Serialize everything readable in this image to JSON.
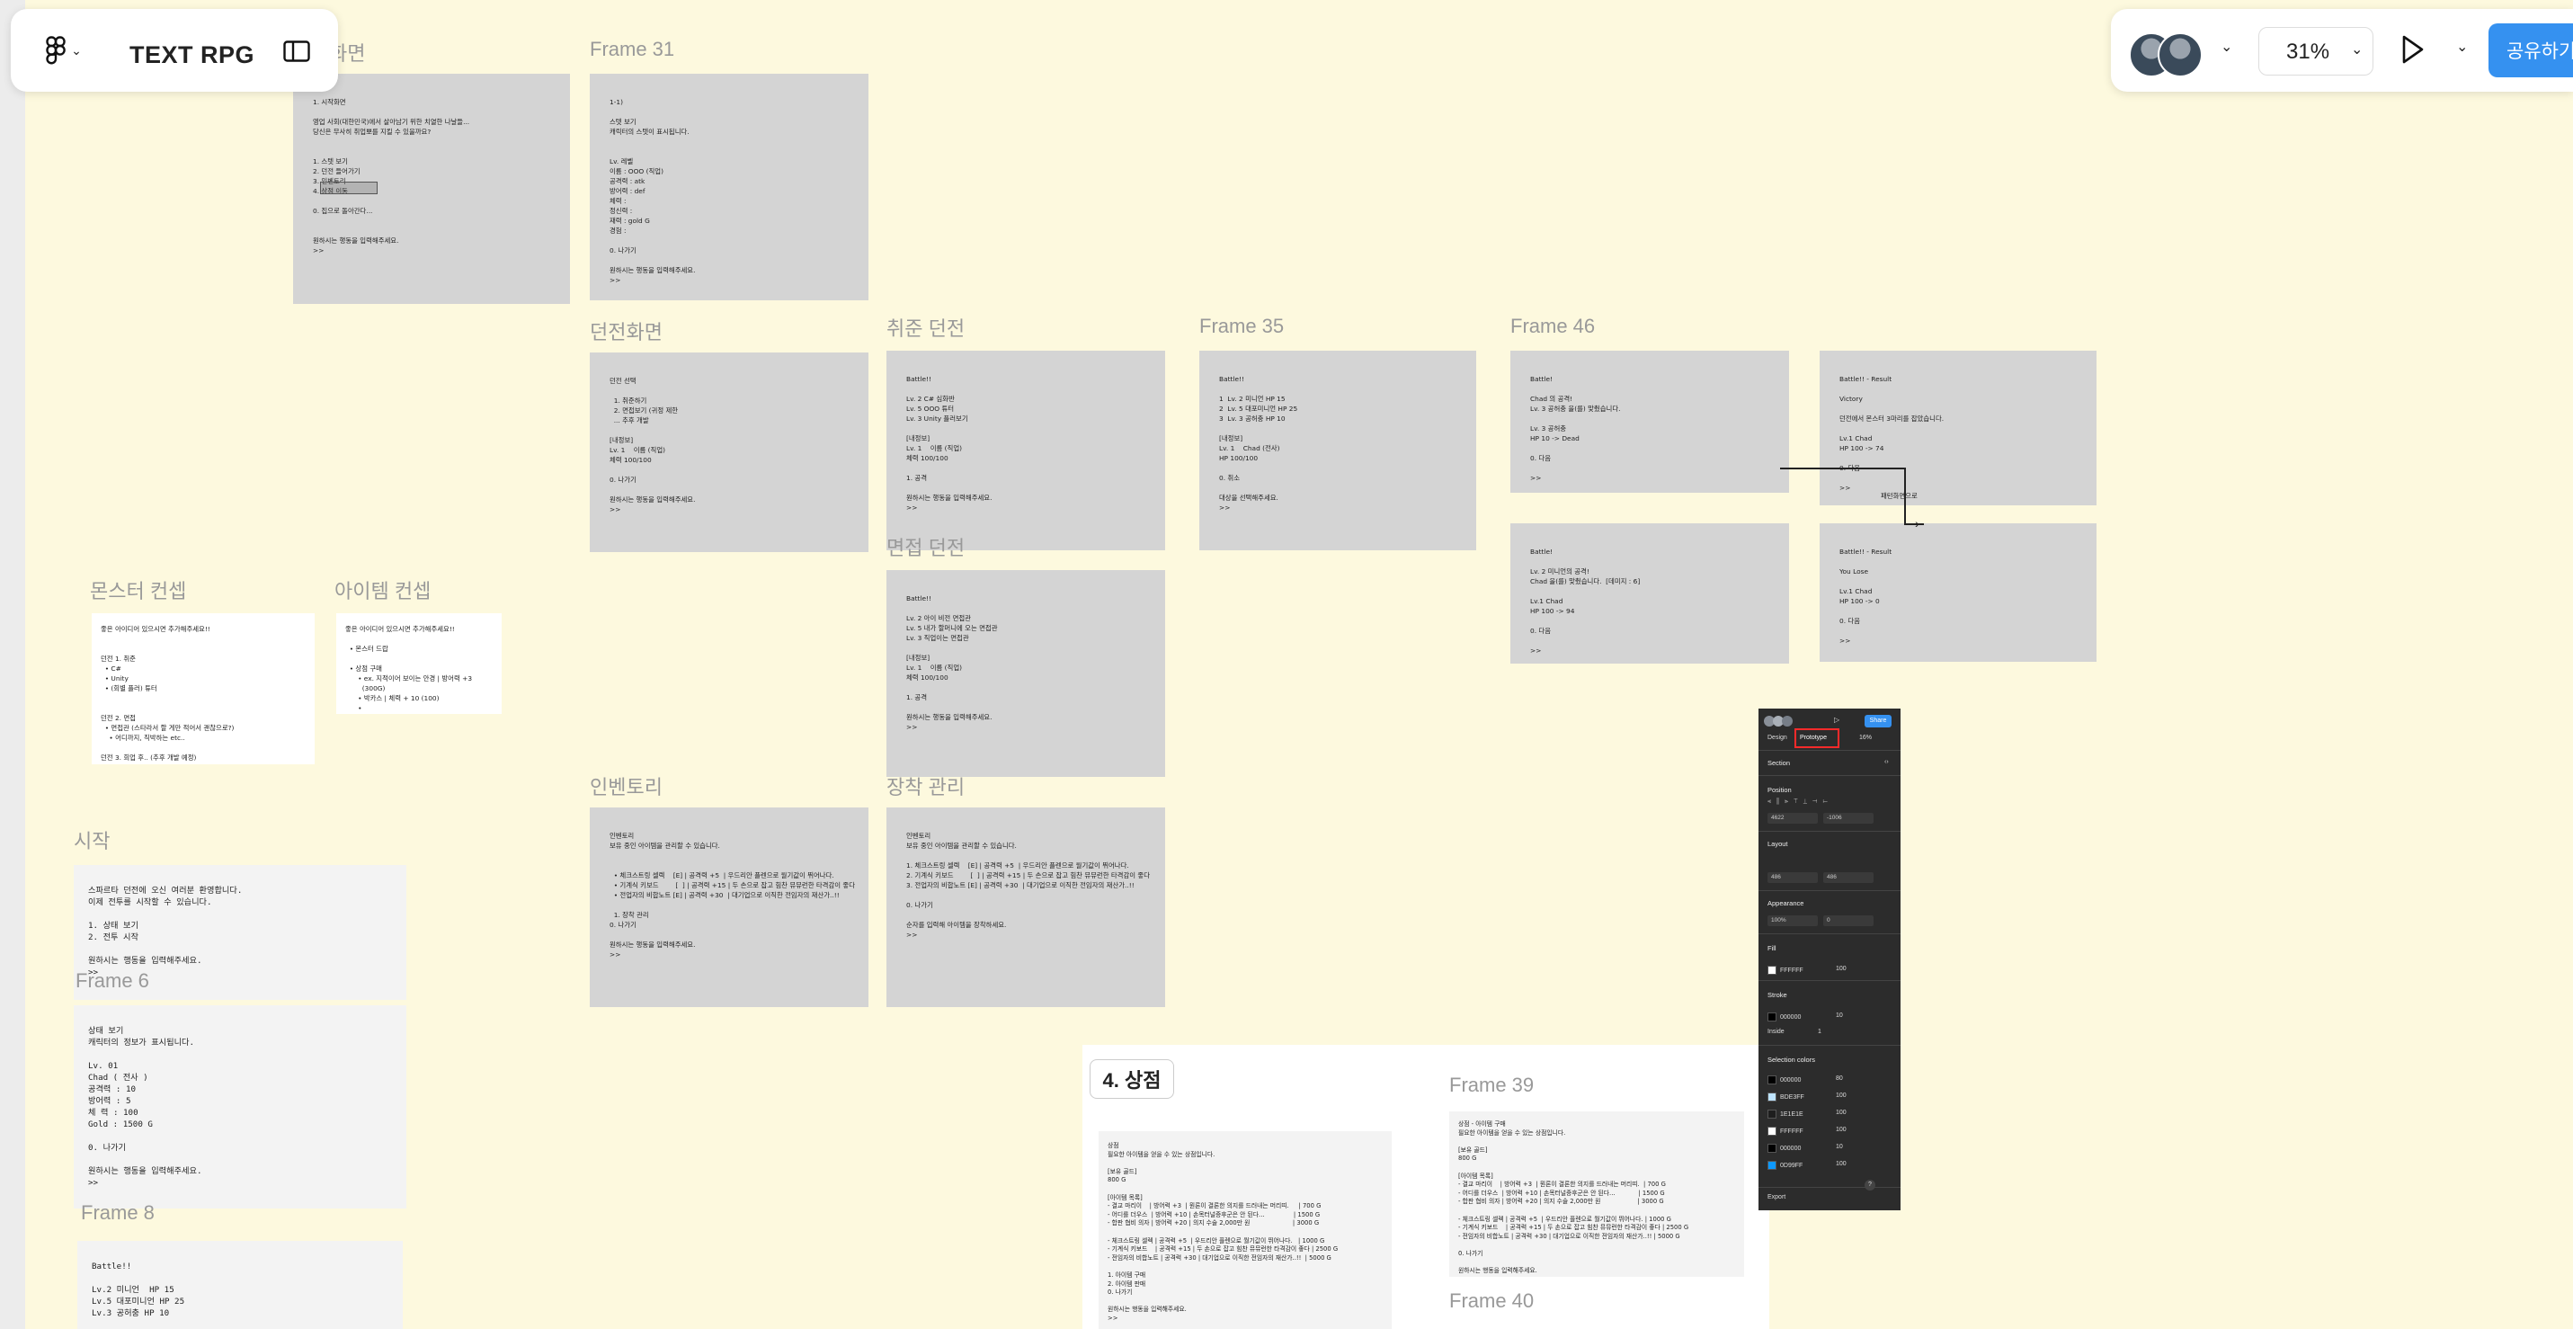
{
  "toolbar": {
    "logo_icon": "figma-logo-icon",
    "file_name": "TEXT RPG",
    "zoom": "31%",
    "share_label": "공유하기"
  },
  "frame_labels": {
    "start_screen": "화면",
    "frame31": "Frame 31",
    "dungeon_screen": "던전화면",
    "job_dungeon": "취준 던전",
    "interview_dungeon": "면접 던전",
    "frame35": "Frame 35",
    "frame46": "Frame 46",
    "monster_concept": "몬스터 컨셉",
    "item_concept": "아이템 컨셉",
    "inventory": "인벤토리",
    "equip_manage": "장착 관리",
    "start": "시작",
    "frame6": "Frame 6",
    "frame8": "Frame 8",
    "frame39": "Frame 39",
    "frame40": "Frame 40",
    "shop_heading": "4. 상점"
  },
  "frame_texts": {
    "start_screen": "1. 시작화면\n\n영업 사회(대한민국)에서 살아남기 위한 치열한 나날들...\n당신은 무사히 취업뽀를 지킬 수 있을까요?\n\n\n1. 스텟 보기\n2. 던전 들어가기\n3. 인벤토리\n4. 상점 이동\n\n0. 집으로 돌아간다...\n\n\n원하시는 행동을 입력해주세요.\n>>",
    "frame31": "1-1)\n\n스텟 보기\n캐릭터의 스텟이 표시됩니다.\n\n\nLv. 레벨\n이름 : OOO (직업)\n공격력 : atk\n방어력 : def\n체력 :\n정신력 :\n재력 : gold G\n경험 :\n\n0. 나가기\n\n원하시는 행동을 입력해주세요.\n>>",
    "dungeon_screen": "던전 선택\n\n  1. 취준하기\n  2. 면접보기 (귀정 제한\n  ... 추후 개발\n\n[내정보]\nLv. 1    이름 (직업)\n체력 100/100\n\n0. 나가기\n\n원하시는 행동을 입력해주세요.\n>>",
    "job_dungeon": "Battle!!\n\nLv. 2 C# 심화반\nLv. 5 OOO 튜터\nLv. 3 Unity 플러보기\n\n[내정보]\nLv. 1    이름 (직업)\n체력 100/100\n\n1. 공격\n\n원하시는 행동을 입력해주세요.\n>>",
    "frame35": "Battle!!\n\n1  Lv. 2 미니언 HP 15\n2  Lv. 5 대포미니언 HP 25\n3  Lv. 3 공허충 HP 10\n\n[내정보]\nLv. 1    Chad (전사)\nHP 100/100\n\n0. 취소\n\n대상을 선택해주세요.\n>>",
    "frame46_a": "Battle!\n\nChad 의 공격!\nLv. 3 공허충 을(를) 맞췄습니다.\n\nLv. 3 공허충\nHP 10 -> Dead\n\n0. 다음\n\n>>",
    "frame46_b": "Battle!! - Result\n\nVictory\n\n던전에서 몬스터 3마리를 잡았습니다.\n\nLv.1 Chad\nHP 100 -> 74\n\n0. 다음\n\n>>",
    "frame46_c": "Battle!\n\nLv. 2 미니언의 공격!\nChad 을(를) 맞췄습니다.  [데미지 : 6]\n\nLv.1 Chad\nHP 100 -> 94\n\n0. 다음\n\n>>",
    "frame46_d": "Battle!! - Result\n\nYou Lose\n\nLv.1 Chad\nHP 100 -> 0\n\n0. 다음\n\n>>",
    "connector_label": "패턴화면으로",
    "interview_dungeon": "Battle!!\n\nLv. 2 아이 비전 면접관\nLv. 5 내가 할머니에 오는 면접관\nLv. 3 직업이는 면접관\n\n[내정보]\nLv. 1    이름 (직업)\n체력 100/100\n\n1. 공격\n\n원하시는 행동을 입력해주세요.\n>>",
    "monster_concept": "좋은 아이디어 있으시면 추가해주세요!!\n\n\n던전 1. 취준\n  • C#\n  • Unity\n  • (회별 플러) 튜터\n\n\n던전 2. 면접\n  • 면접관 (스타라서 할 게만 적어서 괜찮으로?)\n    • 어디까지, 직박하는 etc..\n\n던전 3. 회업 후.. (추후 개발 예정)",
    "item_concept": "좋은 아이디어 있으시면 추가해주세요!!\n\n  • 몬스터 드랍\n\n  • 상점 구매\n      • ex. 지적이어 보이는 안경 | 방어력 +3\n        (300G)\n      • 박카스 | 체력 + 10 (100)\n      •",
    "inventory": "인벤토리\n보유 중인 아이템을 관리할 수 있습니다.\n\n\n  • 체크스트링 셀렉    [E] | 공격력 +5  | 우드리안 플렌으로 월기값이 뛰어나다.\n  • 기계식 키보드        [  ] | 공격력 +15 | 두 손으로 잡고 힘찬 뮤뮤런한 타격감이 좋다\n  • 전업자의 비합노트 [E] | 공격력 +30  | 대기업으로 이직한 전임자의 재산가..!!\n\n  1. 장착 관리\n0. 나가기\n\n원하시는 행동을 입력해주세요.\n>>",
    "equip_manage": "인벤토리\n보유 중인 아이템을 관리할 수 있습니다.\n\n1. 체크스트링 셀렉    [E] | 공격력 +5  | 우드리안 플렌으로 월기값이 뛰어나다.\n2. 기계식 키보드        [  ] | 공격력 +15 | 두 손으로 잡고 힘찬 뮤뮤런한 타격감이 좋다\n3. 전업자의 비합노트 [E] | 공격력 +30  | 대기업으로 이직한 전임자의 재산가..!!\n\n0. 나가기\n\n순자를 입력해 아이템을 장착하세요.\n>>",
    "start": "스파르타 던전에 오신 여러분 환영합니다.\n이제 전투를 시작할 수 있습니다.\n\n1. 상태 보기\n2. 전투 시작\n\n원하시는 행동을 입력해주세요.\n>>",
    "frame6": "상태 보기\n캐릭터의 정보가 표시됩니다.\n\nLv. 01\nChad ( 전사 )\n공격력 : 10\n방어력 : 5\n체 력 : 100\nGold : 1500 G\n\n0. 나가기\n\n원하시는 행동을 입력해주세요.\n>>",
    "frame8": "Battle!!\n\nLv.2 미니언  HP 15\nLv.5 대포미니언 HP 25\nLv.3 공허충 HP 10",
    "shop_main": "상점\n필요한 아이템을 얻을 수 있는 상점입니다.\n\n[보유 골드]\n800 G\n\n[아이템 목록]\n- 결교 마리이    | 방어력 +3  | 뭔론이 결론한 의지를 드러내는 머리띠.     | 700 G\n- 어디를 더우스  | 방어력 +10 | 손목터널증후군은 안 된다...               | 1500 G\n- 합판 협비 의자 | 방어력 +20 | 의지 수술 2,000만 원                      | 3000 G\n\n- 체크스트링 셀렉 | 공격력 +5  | 우드리안 플렌으로 월기값이 뛰어나다.   | 1000 G\n- 기계식 키보드    | 공격력 +15 | 두 손으로 잡고 힘찬 뮤뮤런한 타격감이 좋다 | 2500 G\n- 전임자의 비합노트 | 공격력 +30 | 대기업으로 이직한 전임자의 재산가..!!  | 5000 G\n\n1. 아이템 구매\n2. 아이템 판매\n0. 나가기\n\n원하시는 행동을 입력해주세요.\n>>",
    "frame39": "상점 - 아이템 구매\n필요한 아이템을 얻을 수 있는 상점입니다.\n\n[보유 골드]\n800 G\n\n[아이템 목록]\n- 결교 마리이    | 방어력 +3  | 뭔론이 결론한 의지를 드러내는 머리띠.  | 700 G\n- 어디를 더우스  | 방어력 +10 | 손목터널증후군은 안 된다...            | 1500 G\n- 합판 협비 의자 | 방어력 +20 | 의지 수술 2,000만 원                   | 3000 G\n\n- 체크스트링 셀렉 | 공격력 +5  | 우드리안 플렌으로 월기값이 뛰어나다. | 1000 G\n- 기계식 키보드    | 공격력 +15 | 두 손으로 잡고 힘찬 뮤뮤런한 타격감이 좋다 | 2500 G\n- 전임자의 비합노트 | 공격력 +30 | 대기업으로 이직한 전임자의 재산가..!! | 5000 G\n\n0. 나가기\n\n원하시는 행동을 입력해주세요.\n>>"
  },
  "inspector": {
    "tab_design": "Design",
    "tab_prototype": "Prototype",
    "share": "Share",
    "zoom": "16%",
    "section_label": "Section",
    "position": "Position",
    "x_value": "4622",
    "y_value": "-1006",
    "layout": "Layout",
    "w_value": "486",
    "h_value": "486",
    "appearance": "Appearance",
    "opacity": "100%",
    "radius": "0",
    "fill": "Fill",
    "fill_hex": "FFFFFF",
    "fill_pct": "100",
    "stroke": "Stroke",
    "stroke_hex": "000000",
    "stroke_pct": "10",
    "stroke_pos": "Inside",
    "stroke_w": "1",
    "selection_colors": "Selection colors",
    "colors": [
      {
        "hex": "000000",
        "pct": "80",
        "color": "#000000"
      },
      {
        "hex": "BDE3FF",
        "pct": "100",
        "color": "#bde3ff"
      },
      {
        "hex": "1E1E1E",
        "pct": "100",
        "color": "#1e1e1e"
      },
      {
        "hex": "FFFFFF",
        "pct": "100",
        "color": "#ffffff"
      },
      {
        "hex": "000000",
        "pct": "10",
        "color": "#000000"
      },
      {
        "hex": "0D99FF",
        "pct": "100",
        "color": "#0d99ff"
      }
    ],
    "export": "Export"
  }
}
